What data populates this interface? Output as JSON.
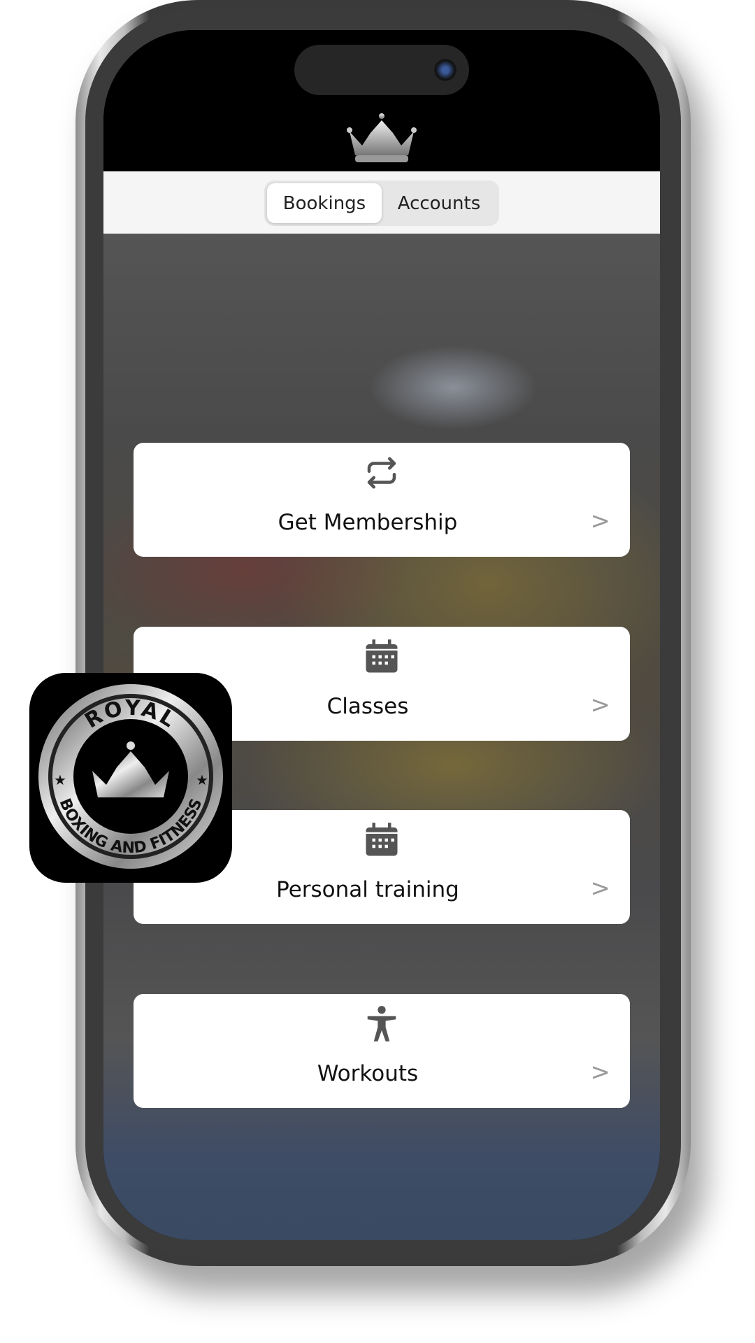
{
  "app": {
    "brand": "Royal Boxing and Fitness",
    "logo_text_top": "ROYAL",
    "logo_text_bottom": "BOXING AND FITNESS"
  },
  "tabs": [
    {
      "label": "Bookings",
      "selected": true
    },
    {
      "label": "Accounts",
      "selected": false
    }
  ],
  "menu": [
    {
      "label": "Get Membership",
      "icon": "repeat-arrows-icon"
    },
    {
      "label": "Classes",
      "icon": "calendar-icon"
    },
    {
      "label": "Personal training",
      "icon": "calendar-icon"
    },
    {
      "label": "Workouts",
      "icon": "accessibility-person-icon"
    }
  ],
  "chevron": ">"
}
